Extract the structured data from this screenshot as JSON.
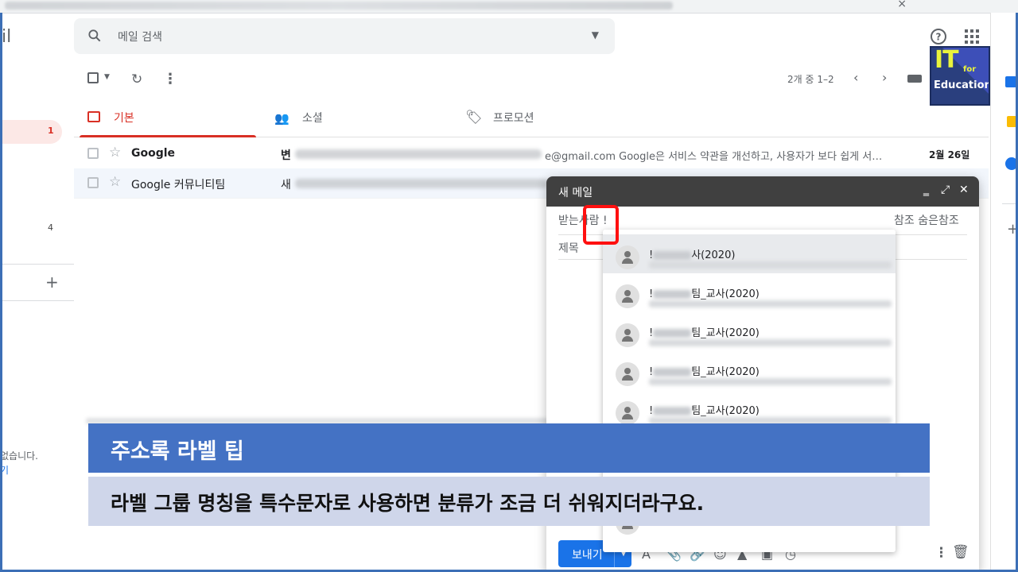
{
  "app": {
    "logo_fragment": "il"
  },
  "search": {
    "placeholder": "메일 검색"
  },
  "toolbar": {
    "pager": "2개 중 1–2"
  },
  "tabs": [
    {
      "label": "기본"
    },
    {
      "label": "소셜"
    },
    {
      "label": "프로모션"
    }
  ],
  "sidebar": {
    "inbox_count": "1",
    "other_count": "4",
    "empty_text": "없습니다.",
    "link_text": "기"
  },
  "emails": [
    {
      "sender": "Google",
      "subject": "변",
      "snippet": "e@gmail.com Google은 서비스 약관을 개선하고, 사용자가 보다 쉽게 서…",
      "date": "2월 26일"
    },
    {
      "sender": "Google 커뮤니티팀",
      "subject": "새",
      "snippet": "",
      "date": ""
    }
  ],
  "compose": {
    "title": "새 메일",
    "to_label": "받는사람",
    "to_value": "!",
    "cc_bcc": "참조 숨은참조",
    "subject_label": "제목",
    "send_label": "보내기"
  },
  "suggestions": [
    {
      "prefix": "!",
      "suffix": "사(2020)"
    },
    {
      "prefix": "!",
      "suffix": "팀_교사(2020)"
    },
    {
      "prefix": "!",
      "suffix": "팀_교사(2020)"
    },
    {
      "prefix": "!",
      "suffix": "팀_교사(2020)"
    },
    {
      "prefix": "!",
      "suffix": "팀_교사(2020)"
    }
  ],
  "badge": {
    "big": "IT",
    "small": "for",
    "word": "Education"
  },
  "caption": {
    "title": "주소록 라벨 팁",
    "body": "라벨 그룹 명칭을 특수문자로 사용하면 분류가 조금 더 쉬워지더라구요."
  },
  "colors": {
    "accent_red": "#d93025",
    "caption_blue": "#4472c4",
    "caption_body_bg": "#cfd6ea",
    "highlight": "#ff1010"
  }
}
